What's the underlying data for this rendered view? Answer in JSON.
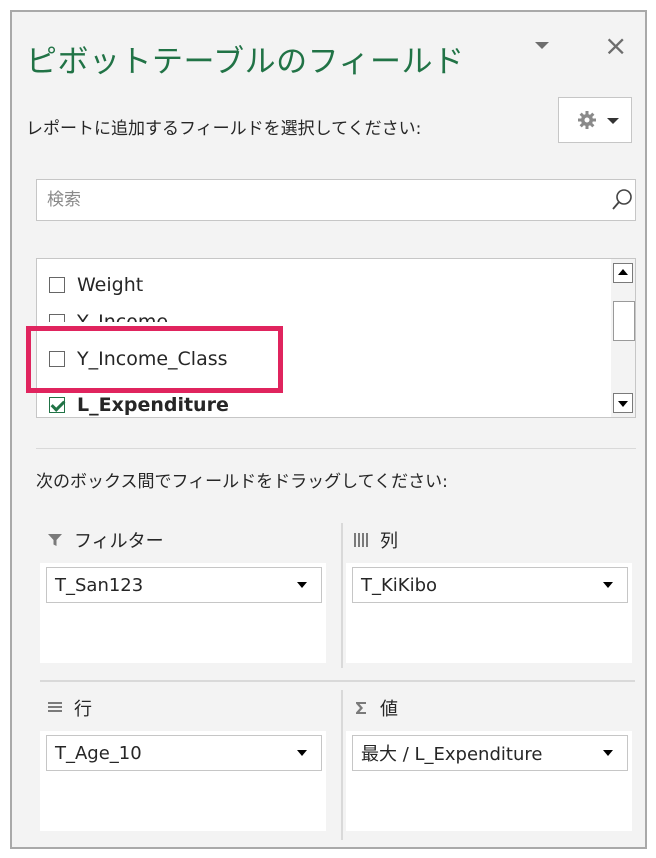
{
  "pane": {
    "title": "ピボットテーブルのフィールド",
    "subtitle": "レポートに追加するフィールドを選択してください:",
    "close_label": "×"
  },
  "search": {
    "placeholder": "検索"
  },
  "fields": [
    {
      "label": "Weight",
      "checked": false
    },
    {
      "label": "Y_Income",
      "checked": false
    },
    {
      "label": "Y_Income_Class",
      "checked": false
    },
    {
      "label": "L_Expenditure",
      "checked": true
    }
  ],
  "drag_instruction": "次のボックス間でフィールドをドラッグしてください:",
  "areas": {
    "filters": {
      "label": "フィルター",
      "items": [
        "T_San123"
      ]
    },
    "columns": {
      "label": "列",
      "items": [
        "T_KiKibo"
      ]
    },
    "rows": {
      "label": "行",
      "items": [
        "T_Age_10"
      ]
    },
    "values": {
      "label": "値",
      "items": [
        "最大 / L_Expenditure"
      ]
    }
  },
  "colors": {
    "title": "#217346",
    "highlight": "#e0245e",
    "checkbox_checked": "#217346"
  },
  "icons": {
    "settings": "gear-icon",
    "search": "search-icon",
    "filter": "filter-icon",
    "columns": "columns-icon",
    "rows": "rows-icon",
    "values": "sigma-icon"
  }
}
